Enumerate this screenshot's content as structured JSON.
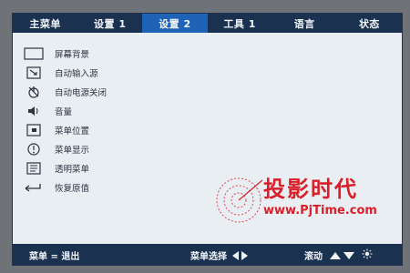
{
  "tabs": [
    {
      "label": "主菜单",
      "active": false
    },
    {
      "label": "设置 1",
      "active": false
    },
    {
      "label": "设置 2",
      "active": true
    },
    {
      "label": "工具 1",
      "active": false
    },
    {
      "label": "语言",
      "active": false
    },
    {
      "label": "状态",
      "active": false
    }
  ],
  "menu_items": [
    {
      "label": "屏幕背景",
      "icon": "screen-background-icon"
    },
    {
      "label": "自动输入源",
      "icon": "auto-source-icon"
    },
    {
      "label": "自动电源关闭",
      "icon": "auto-power-off-icon"
    },
    {
      "label": "音量",
      "icon": "volume-icon"
    },
    {
      "label": "菜单位置",
      "icon": "menu-position-icon"
    },
    {
      "label": "菜单显示",
      "icon": "menu-display-icon"
    },
    {
      "label": "透明菜单",
      "icon": "transparent-menu-icon"
    },
    {
      "label": "恢复原值",
      "icon": "reset-icon"
    }
  ],
  "footer": {
    "exit_hint": "菜单 = 退出",
    "select_hint": "菜单选择",
    "scroll_hint": "滚动"
  },
  "watermark": {
    "title": "投影时代",
    "url": "www.PjTime.com"
  },
  "colors": {
    "tab_bar": "#1b3150",
    "active_tab": "#1f63b7",
    "panel": "#e9eef3",
    "watermark": "#d9202a"
  }
}
